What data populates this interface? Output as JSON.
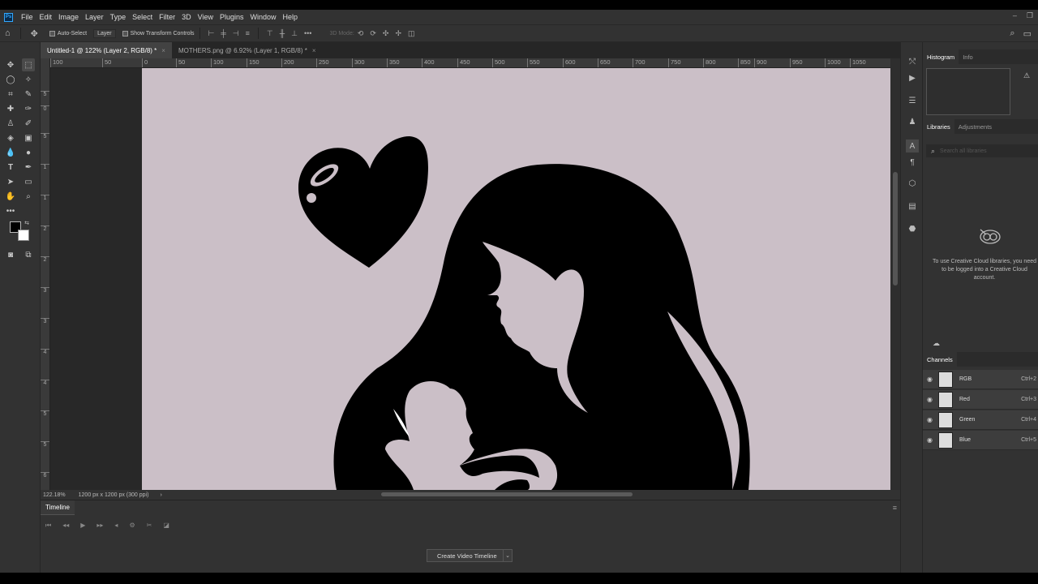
{
  "menu": [
    "File",
    "Edit",
    "Image",
    "Layer",
    "Type",
    "Select",
    "Filter",
    "3D",
    "View",
    "Plugins",
    "Window",
    "Help"
  ],
  "options": {
    "auto_select": "Auto-Select",
    "layer_select": "Layer",
    "show_transform": "Show Transform Controls",
    "mode_3d": "3D Mode:"
  },
  "tabs": [
    {
      "label": "Untitled-1 @ 122% (Layer 2, RGB/8) *",
      "close": "×"
    },
    {
      "label": "MOTHERS.png @ 6.92% (Layer 1, RGB/8) *",
      "close": "×"
    }
  ],
  "ruler_h": [
    "100",
    "50",
    "0",
    "50",
    "100",
    "150",
    "200",
    "250",
    "300",
    "350",
    "400",
    "450",
    "500",
    "550",
    "600",
    "650",
    "700",
    "750",
    "800",
    "850",
    "900",
    "950",
    "1000",
    "1050"
  ],
  "ruler_v": [
    "5",
    "0",
    "5",
    "1",
    "1",
    "2",
    "2",
    "3",
    "3",
    "4",
    "4",
    "5",
    "5",
    "6"
  ],
  "status": {
    "zoom": "122.18%",
    "doc_info": "1200 px x 1200 px (300 ppi)",
    "arrow": "›"
  },
  "timeline": {
    "title": "Timeline",
    "create_label": "Create Video Timeline",
    "dropdown_arrow": "⌄",
    "menu": "≡"
  },
  "panels": {
    "histogram_tab": "Histogram",
    "info_tab": "Info",
    "libraries_tab": "Libraries",
    "adjustments_tab": "Adjustments",
    "search_placeholder": "Search all libraries",
    "lib_message": "To use Creative Cloud libraries, you need to be logged into a Creative Cloud account.",
    "channels_tab": "Channels"
  },
  "channels": [
    {
      "name": "RGB",
      "shortcut": "Ctrl+2"
    },
    {
      "name": "Red",
      "shortcut": "Ctrl+3"
    },
    {
      "name": "Green",
      "shortcut": "Ctrl+4"
    },
    {
      "name": "Blue",
      "shortcut": "Ctrl+5"
    }
  ],
  "colors": {
    "canvas_bg": "#cbbfc7",
    "silhouette": "#000000",
    "accent": "#31a8ff"
  }
}
